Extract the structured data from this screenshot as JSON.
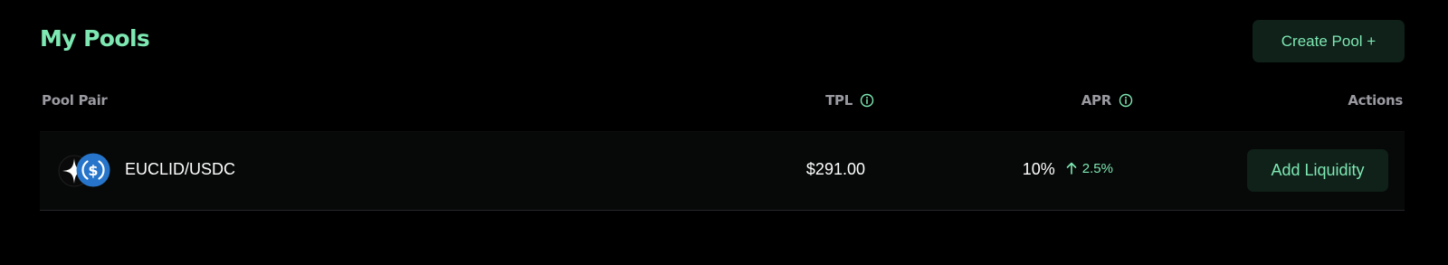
{
  "page": {
    "title": "My Pools",
    "create_button_label": "Create Pool +"
  },
  "colors": {
    "accent": "#7ee8b3",
    "button_bg": "#0f2119",
    "background": "#000000",
    "header_text": "#9a9aa1"
  },
  "table": {
    "headers": {
      "pool_pair": "Pool Pair",
      "tpl": "TPL",
      "apr": "APR",
      "actions": "Actions"
    },
    "header_icons": {
      "tpl": "info-icon",
      "apr": "info-icon"
    },
    "rows": [
      {
        "pair": "EUCLID/USDC",
        "tokens": [
          "euclid-token-icon",
          "usdc-token-icon"
        ],
        "tpl": "$291.00",
        "apr": "10%",
        "apr_change": "2.5%",
        "apr_change_icon": "arrow-up-icon",
        "action_label": "Add Liquidity"
      }
    ]
  }
}
